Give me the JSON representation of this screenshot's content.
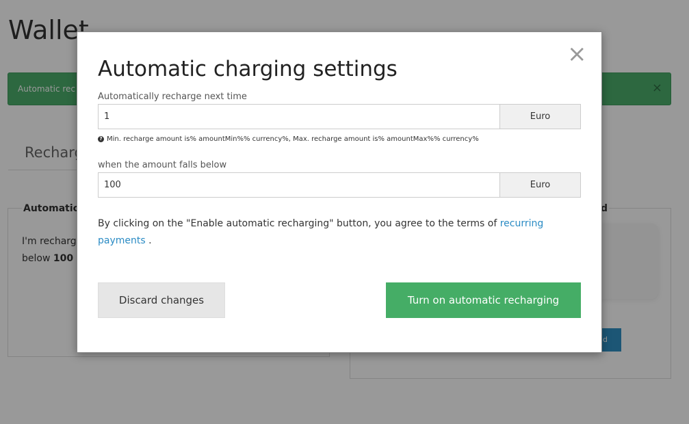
{
  "background": {
    "page_title": "Wallet",
    "alert_text": "Automatic rec",
    "alert_close": "×",
    "tab_label": "Recharg",
    "left_panel_title": "Automatic",
    "left_panel_line1": "I'm recharg",
    "left_panel_line2_prefix": "below ",
    "left_panel_line2_bold": "100",
    "right_panel_title": "d",
    "right_button_label": "d"
  },
  "modal": {
    "title": "Automatic charging settings",
    "close_glyph": "×",
    "recharge_label": "Automatically recharge next time",
    "recharge_value": "1",
    "recharge_currency": "Euro",
    "hint_icon": "?",
    "hint_text": "Min. recharge amount is% amountMin%% currency%, Max. recharge amount is% amountMax%% currency%",
    "threshold_label": "when the amount falls below",
    "threshold_value": "100",
    "threshold_currency": "Euro",
    "terms_text": "By clicking on the \"Enable automatic recharging\" button, you agree to the terms of ",
    "terms_link_text": "recurring payments",
    "terms_suffix": " .",
    "discard_label": "Discard changes",
    "enable_label": "Turn on automatic recharging"
  },
  "colors": {
    "primary_green": "#45ad66",
    "link_blue": "#2a8bc4",
    "alert_green": "#4cae6c"
  }
}
